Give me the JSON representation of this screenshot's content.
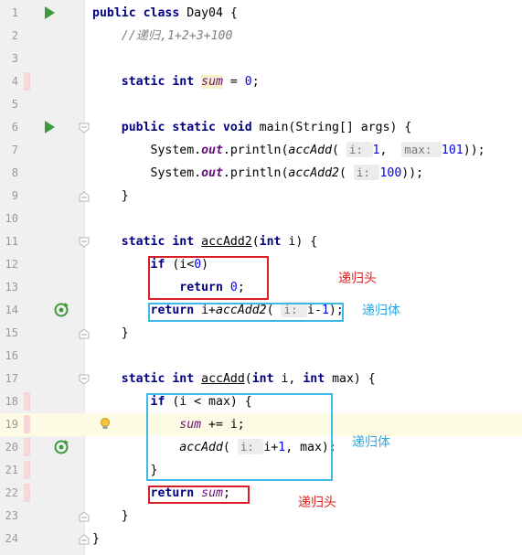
{
  "editor": {
    "lines": [
      {
        "num": "1",
        "tokens": [
          {
            "t": "public class",
            "c": "kw"
          },
          {
            "t": " Day04 {"
          }
        ]
      },
      {
        "num": "2",
        "tokens": [
          {
            "t": "    "
          },
          {
            "t": "//递归,1+2+3+100",
            "c": "cm"
          }
        ]
      },
      {
        "num": "3",
        "tokens": []
      },
      {
        "num": "4",
        "tokens": [
          {
            "t": "    "
          },
          {
            "t": "static int",
            "c": "kw"
          },
          {
            "t": " "
          },
          {
            "t": "sum",
            "c": "sf varhl"
          },
          {
            "t": " = "
          },
          {
            "t": "0",
            "c": "num"
          },
          {
            "t": ";"
          }
        ]
      },
      {
        "num": "5",
        "tokens": []
      },
      {
        "num": "6",
        "tokens": [
          {
            "t": "    "
          },
          {
            "t": "public static void",
            "c": "kw"
          },
          {
            "t": " main(String[] args) {"
          }
        ]
      },
      {
        "num": "7",
        "tokens": [
          {
            "t": "        System."
          },
          {
            "t": "out",
            "c": "fs"
          },
          {
            "t": ".println("
          },
          {
            "t": "accAdd",
            "c": "mi"
          },
          {
            "t": "( "
          },
          {
            "t": "i: ",
            "c": "hint"
          },
          {
            "t": "1",
            "c": "num"
          },
          {
            "t": ",  "
          },
          {
            "t": "max: ",
            "c": "hint"
          },
          {
            "t": "101",
            "c": "num"
          },
          {
            "t": "));"
          }
        ]
      },
      {
        "num": "8",
        "tokens": [
          {
            "t": "        System."
          },
          {
            "t": "out",
            "c": "fs"
          },
          {
            "t": ".println("
          },
          {
            "t": "accAdd2",
            "c": "mi"
          },
          {
            "t": "( "
          },
          {
            "t": "i: ",
            "c": "hint"
          },
          {
            "t": "100",
            "c": "num"
          },
          {
            "t": "));"
          }
        ]
      },
      {
        "num": "9",
        "tokens": [
          {
            "t": "    }"
          }
        ]
      },
      {
        "num": "10",
        "tokens": []
      },
      {
        "num": "11",
        "tokens": [
          {
            "t": "    "
          },
          {
            "t": "static int",
            "c": "kw"
          },
          {
            "t": " "
          },
          {
            "t": "accAdd2",
            "c": "uline"
          },
          {
            "t": "("
          },
          {
            "t": "int",
            "c": "kw"
          },
          {
            "t": " i) {"
          }
        ]
      },
      {
        "num": "12",
        "tokens": [
          {
            "t": "        "
          },
          {
            "t": "if",
            "c": "kw"
          },
          {
            "t": " (i<"
          },
          {
            "t": "0",
            "c": "num"
          },
          {
            "t": ")"
          }
        ]
      },
      {
        "num": "13",
        "tokens": [
          {
            "t": "            "
          },
          {
            "t": "return",
            "c": "kw"
          },
          {
            "t": " "
          },
          {
            "t": "0",
            "c": "num"
          },
          {
            "t": ";"
          }
        ]
      },
      {
        "num": "14",
        "tokens": [
          {
            "t": "        "
          },
          {
            "t": "return",
            "c": "kw"
          },
          {
            "t": " i+"
          },
          {
            "t": "accAdd2",
            "c": "mi"
          },
          {
            "t": "( "
          },
          {
            "t": "i: ",
            "c": "hint"
          },
          {
            "t": "i-"
          },
          {
            "t": "1",
            "c": "num"
          },
          {
            "t": ");"
          }
        ]
      },
      {
        "num": "15",
        "tokens": [
          {
            "t": "    }"
          }
        ]
      },
      {
        "num": "16",
        "tokens": []
      },
      {
        "num": "17",
        "tokens": [
          {
            "t": "    "
          },
          {
            "t": "static int",
            "c": "kw"
          },
          {
            "t": " "
          },
          {
            "t": "accAdd",
            "c": "uline"
          },
          {
            "t": "("
          },
          {
            "t": "int",
            "c": "kw"
          },
          {
            "t": " i, "
          },
          {
            "t": "int",
            "c": "kw"
          },
          {
            "t": " max) {"
          }
        ]
      },
      {
        "num": "18",
        "tokens": [
          {
            "t": "        "
          },
          {
            "t": "if",
            "c": "kw"
          },
          {
            "t": " (i < max) {"
          }
        ]
      },
      {
        "num": "19",
        "tokens": [
          {
            "t": "            "
          },
          {
            "t": "sum",
            "c": "sf"
          },
          {
            "t": " += i;"
          }
        ]
      },
      {
        "num": "20",
        "tokens": [
          {
            "t": "            "
          },
          {
            "t": "accAdd",
            "c": "mi"
          },
          {
            "t": "( "
          },
          {
            "t": "i: ",
            "c": "hint"
          },
          {
            "t": "i+"
          },
          {
            "t": "1",
            "c": "num"
          },
          {
            "t": ", max);"
          }
        ]
      },
      {
        "num": "21",
        "tokens": [
          {
            "t": "        }"
          }
        ]
      },
      {
        "num": "22",
        "tokens": [
          {
            "t": "        "
          },
          {
            "t": "return",
            "c": "kw"
          },
          {
            "t": " "
          },
          {
            "t": "sum",
            "c": "sf"
          },
          {
            "t": ";"
          }
        ]
      },
      {
        "num": "23",
        "tokens": [
          {
            "t": "    }"
          }
        ]
      },
      {
        "num": "24",
        "tokens": [
          {
            "t": "}"
          }
        ]
      }
    ],
    "highlight_line": "19",
    "changed_lines": [
      "4",
      "18",
      "19",
      "20",
      "21",
      "22"
    ],
    "run_icon_lines": [
      "1",
      "6"
    ],
    "recursion_icon_lines": [
      "14",
      "20"
    ],
    "fold_open_lines": [
      "6",
      "11",
      "17"
    ],
    "fold_close_lines": [
      "9",
      "15",
      "23",
      "24"
    ],
    "bulb_line": "19"
  },
  "annotations": {
    "base_case_1": "递归头",
    "body_1": "递归体",
    "body_2": "递归体",
    "base_case_2": "递归头"
  },
  "colors": {
    "keyword": "#000080",
    "number": "#0000ff",
    "comment": "#808080",
    "static_field": "#660e7a",
    "red_box": "#d61f26",
    "blue_box": "#3cb9ea",
    "current_line": "#fdfbe3"
  },
  "icons": {
    "run": "run-triangle-icon",
    "recursion": "recursive-call-icon",
    "fold": "fold-marker-icon",
    "bulb": "intention-bulb-icon"
  }
}
